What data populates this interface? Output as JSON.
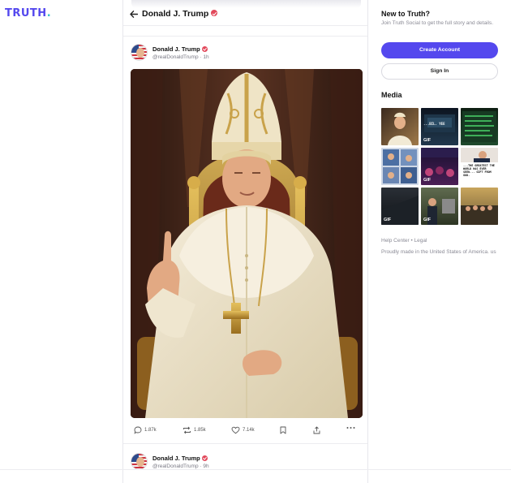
{
  "brand": {
    "logo_main": "TRUTH",
    "logo_dot": ".",
    "accent": "#5448ee",
    "dot_color": "#38c0c6"
  },
  "header": {
    "title": "Donald J. Trump",
    "back_icon": "arrow-left-icon"
  },
  "post": {
    "author": "Donald J. Trump",
    "handle": "@realDonaldTrump",
    "time": "1h",
    "image_alt": "Illustration of Donald Trump dressed as the Pope, seated on a gilded throne, raising one finger",
    "actions": {
      "replies": "1.87k",
      "retruths": "1.85k",
      "likes": "7.14k"
    }
  },
  "next_post": {
    "author": "Donald J. Trump",
    "handle": "@realDonaldTrump",
    "time": "9h"
  },
  "sidebar": {
    "new_title": "New to Truth?",
    "new_desc": "Join Truth Social to get the full story and details.",
    "create_label": "Create Account",
    "signin_label": "Sign In",
    "media_title": "Media",
    "media": [
      {
        "type": "image",
        "caption": ""
      },
      {
        "type": "gif",
        "caption": "...BIL. YEE",
        "gif_label": "GIF"
      },
      {
        "type": "image",
        "caption": ""
      },
      {
        "type": "image",
        "caption": ""
      },
      {
        "type": "gif",
        "caption": "",
        "gif_label": "GIF"
      },
      {
        "type": "image",
        "caption": "...THE GREATEST THE WORLD HAS EVER SEEN... GIFT FROM GOD."
      },
      {
        "type": "gif",
        "caption": "",
        "gif_label": "GIF"
      },
      {
        "type": "gif",
        "caption": "",
        "gif_label": "GIF"
      },
      {
        "type": "image",
        "caption": ""
      }
    ],
    "footer_links": "Help Center • Legal",
    "footer_made": "Proudly made in the United States of America. us"
  }
}
